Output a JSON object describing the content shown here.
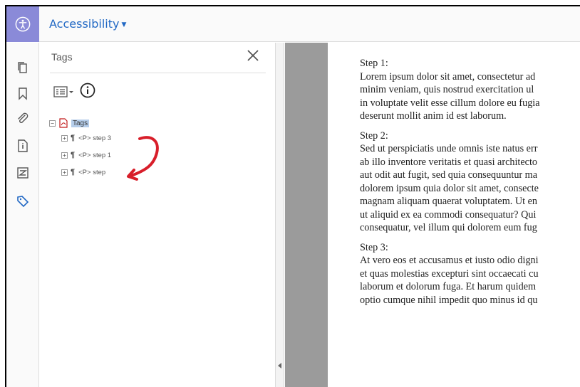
{
  "toolbar": {
    "title": "Accessibility"
  },
  "left_rail": {
    "icons": [
      "pages-icon",
      "bookmark-icon",
      "attachment-icon",
      "document-properties-icon",
      "content-icon",
      "tags-icon"
    ]
  },
  "tags_panel": {
    "title": "Tags",
    "tree": {
      "root_label": "Tags",
      "children": [
        {
          "label": "<P> step 3"
        },
        {
          "label": "<P> step 1"
        },
        {
          "label": "<P> step"
        }
      ]
    }
  },
  "annotation": {
    "arrow_color": "#d81e2a"
  },
  "colors": {
    "accent": "#2168c4",
    "tile": "#8a8ad8",
    "selection": "#b5cdea"
  },
  "document": {
    "steps": [
      {
        "heading": "Step 1:",
        "lines": [
          "Lorem ipsum dolor sit amet, consectetur ad",
          "minim veniam, quis nostrud exercitation ul",
          "in voluptate velit esse cillum dolore eu fugia",
          "deserunt mollit anim id est laborum."
        ]
      },
      {
        "heading": "Step 2:",
        "lines": [
          "Sed ut perspiciatis unde omnis iste natus err",
          "ab illo inventore veritatis et quasi architecto",
          "aut odit aut fugit, sed quia consequuntur ma",
          "dolorem ipsum quia dolor sit amet, consecte",
          "magnam aliquam quaerat voluptatem. Ut en",
          "ut aliquid ex ea commodi consequatur? Qui",
          "consequatur, vel illum qui dolorem eum fug"
        ]
      },
      {
        "heading": "Step 3:",
        "lines": [
          "At vero eos et accusamus et iusto odio digni",
          "et quas molestias excepturi sint occaecati cu",
          "laborum et dolorum fuga. Et harum quidem",
          "optio cumque nihil impedit quo minus id qu"
        ]
      }
    ]
  }
}
